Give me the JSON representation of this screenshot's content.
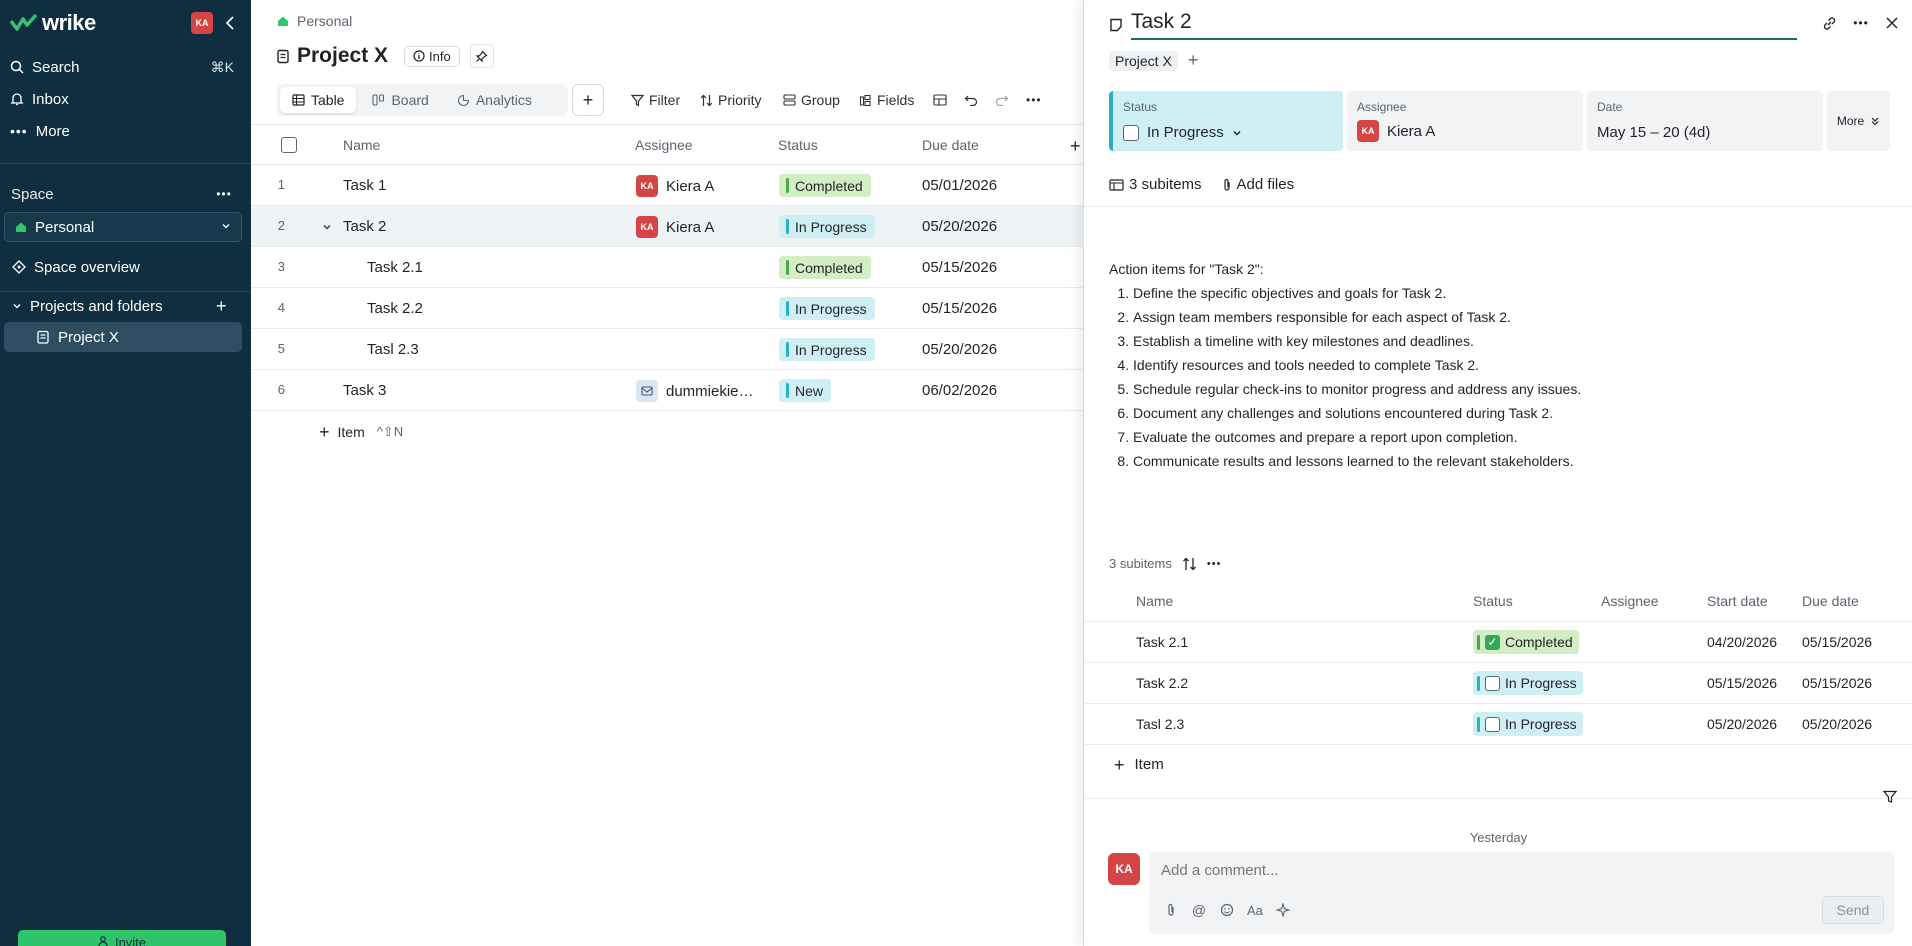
{
  "sidebar": {
    "logo": "wrike",
    "avatar": "KA",
    "nav": [
      {
        "label": "Search",
        "shortcut": "⌘K"
      },
      {
        "label": "Inbox"
      },
      {
        "label": "More"
      }
    ],
    "space_section": "Space",
    "space_selected": "Personal",
    "space_overview": "Space overview",
    "projects_label": "Projects and folders",
    "project_item": "Project X",
    "invite": "Invite"
  },
  "main": {
    "breadcrumb": "Personal",
    "title": "Project X",
    "info": "Info",
    "views": [
      "Table",
      "Board",
      "Analytics"
    ],
    "toolbar": {
      "filter": "Filter",
      "priority": "Priority",
      "group": "Group",
      "fields": "Fields"
    },
    "columns": {
      "name": "Name",
      "assignee": "Assignee",
      "status": "Status",
      "due": "Due date"
    },
    "rows": [
      {
        "num": "1",
        "name": "Task 1",
        "assignee": "Kiera A",
        "avatar": "KA",
        "status": "Completed",
        "due": "05/01/2026"
      },
      {
        "num": "2",
        "name": "Task 2",
        "assignee": "Kiera A",
        "avatar": "KA",
        "status": "In Progress",
        "due": "05/20/2026"
      },
      {
        "num": "3",
        "name": "Task 2.1",
        "assignee": "",
        "status": "Completed",
        "due": "05/15/2026"
      },
      {
        "num": "4",
        "name": "Task 2.2",
        "assignee": "",
        "status": "In Progress",
        "due": "05/15/2026"
      },
      {
        "num": "5",
        "name": "Tasl 2.3",
        "assignee": "",
        "status": "In Progress",
        "due": "05/20/2026"
      },
      {
        "num": "6",
        "name": "Task 3",
        "assignee": "dummiekie…",
        "status": "New",
        "due": "06/02/2026"
      }
    ],
    "add_item": "Item",
    "add_item_shortcut": "^⇧N"
  },
  "panel": {
    "title": "Task 2",
    "tag": "Project X",
    "status_label": "Status",
    "status_value": "In Progress",
    "assignee_label": "Assignee",
    "assignee_value": "Kiera A",
    "assignee_avatar": "KA",
    "date_label": "Date",
    "date_value": "May 15 – 20 (4d)",
    "more": "More",
    "subitems_count": "3 subitems",
    "add_files": "Add files",
    "description_intro": "Action items for \"Task 2\":",
    "description_items": [
      "Define the specific objectives and goals for Task 2.",
      "Assign team members responsible for each aspect of Task 2.",
      "Establish a timeline with key milestones and deadlines.",
      "Identify resources and tools needed to complete Task 2.",
      "Schedule regular check-ins to monitor progress and address any issues.",
      "Document any challenges and solutions encountered during Task 2.",
      "Evaluate the outcomes and prepare a report upon completion.",
      "Communicate results and lessons learned to the relevant stakeholders."
    ],
    "subitems_header": "3 subitems",
    "sub_columns": {
      "name": "Name",
      "status": "Status",
      "assignee": "Assignee",
      "start": "Start date",
      "due": "Due date"
    },
    "subitems": [
      {
        "name": "Task 2.1",
        "status": "Completed",
        "start": "04/20/2026",
        "due": "05/15/2026"
      },
      {
        "name": "Task 2.2",
        "status": "In Progress",
        "start": "05/15/2026",
        "due": "05/15/2026"
      },
      {
        "name": "Tasl 2.3",
        "status": "In Progress",
        "start": "05/20/2026",
        "due": "05/20/2026"
      }
    ],
    "add_item": "Item",
    "yesterday": "Yesterday",
    "comment_avatar": "KA",
    "comment_placeholder": "Add a comment...",
    "text_format": "Aa",
    "send": "Send"
  }
}
